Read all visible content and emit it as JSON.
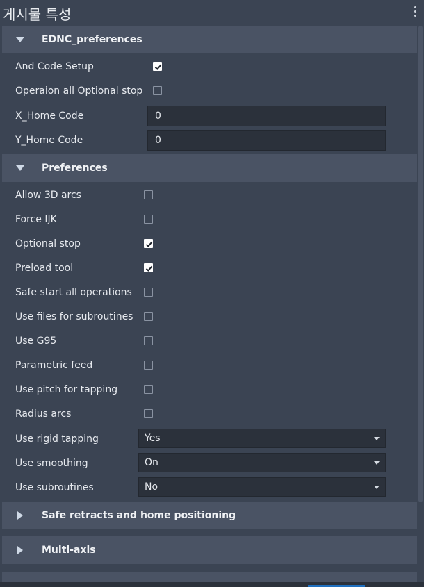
{
  "title": "게시물 특성",
  "sections": {
    "ednc": {
      "label": "EDNC_preferences",
      "rows": {
        "and_code_setup": {
          "label": "And Code Setup",
          "checked": true
        },
        "operaion_optional_stop": {
          "label": "Operaion all Optional stop",
          "checked": false
        },
        "x_home_code": {
          "label": "X_Home Code",
          "value": "0"
        },
        "y_home_code": {
          "label": "Y_Home Code",
          "value": "0"
        }
      }
    },
    "preferences": {
      "label": "Preferences",
      "rows": {
        "allow_3d_arcs": {
          "label": "Allow 3D arcs",
          "checked": false
        },
        "force_ijk": {
          "label": "Force IJK",
          "checked": false
        },
        "optional_stop": {
          "label": "Optional stop",
          "checked": true
        },
        "preload_tool": {
          "label": "Preload tool",
          "checked": true
        },
        "safe_start": {
          "label": "Safe start all operations",
          "checked": false
        },
        "use_files_subroutines": {
          "label": "Use files for subroutines",
          "checked": false
        },
        "use_g95": {
          "label": "Use G95",
          "checked": false
        },
        "parametric_feed": {
          "label": "Parametric feed",
          "checked": false
        },
        "use_pitch_tapping": {
          "label": "Use pitch for tapping",
          "checked": false
        },
        "radius_arcs": {
          "label": "Radius arcs",
          "checked": false
        },
        "use_rigid_tapping": {
          "label": "Use rigid tapping",
          "value": "Yes"
        },
        "use_smoothing": {
          "label": "Use smoothing",
          "value": "On"
        },
        "use_subroutines": {
          "label": "Use subroutines",
          "value": "No"
        }
      }
    },
    "safe_retracts": {
      "label": "Safe retracts and home positioning"
    },
    "multi_axis": {
      "label": "Multi-axis"
    }
  },
  "icons": {
    "expanded": "triangle-down-icon",
    "collapsed": "triangle-right-icon",
    "checked": "checkmark-icon",
    "menu": "kebab-menu-icon"
  },
  "colors": {
    "background": "#3b4453",
    "section_header": "#4a5364",
    "field_background": "#2b313b",
    "accent": "#1f6fbf"
  }
}
